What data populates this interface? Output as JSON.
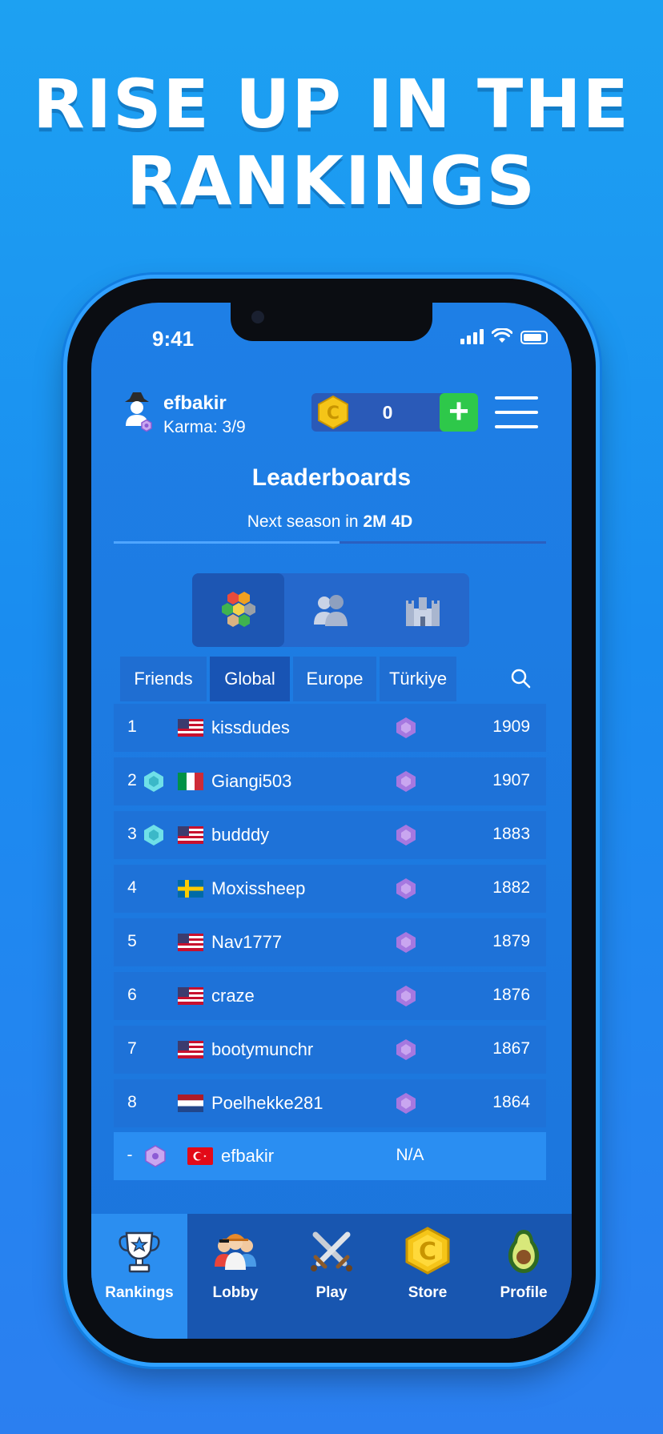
{
  "headline": {
    "line1": "RISE UP IN THE",
    "line2": "RANKINGS"
  },
  "status_bar": {
    "time": "9:41"
  },
  "user": {
    "name": "efbakir",
    "karma": "Karma: 3/9"
  },
  "currency": {
    "count": "0",
    "add_label": "+"
  },
  "page": {
    "title": "Leaderboards",
    "season_prefix": "Next season in ",
    "season_value": "2M 4D"
  },
  "mode_tabs": [
    {
      "icon": "hex-board-icon",
      "active": true
    },
    {
      "icon": "players-icon",
      "active": false
    },
    {
      "icon": "castle-icon",
      "active": false
    }
  ],
  "region_tabs": [
    {
      "label": "Friends",
      "active": false
    },
    {
      "label": "Global",
      "active": true
    },
    {
      "label": "Europe",
      "active": false
    },
    {
      "label": "Türkiye",
      "active": false
    }
  ],
  "leaderboard": [
    {
      "rank": "1",
      "badge": "",
      "flag": "us",
      "name": "kissdudes",
      "score": "1909"
    },
    {
      "rank": "2",
      "badge": "cyan-hex",
      "flag": "it",
      "name": "Giangi503",
      "score": "1907"
    },
    {
      "rank": "3",
      "badge": "cyan-hex",
      "flag": "us",
      "name": "budddy",
      "score": "1883"
    },
    {
      "rank": "4",
      "badge": "",
      "flag": "se",
      "name": "Moxissheep",
      "score": "1882"
    },
    {
      "rank": "5",
      "badge": "",
      "flag": "us",
      "name": "Nav1777",
      "score": "1879"
    },
    {
      "rank": "6",
      "badge": "",
      "flag": "us",
      "name": "craze",
      "score": "1876"
    },
    {
      "rank": "7",
      "badge": "",
      "flag": "us",
      "name": "bootymunchr",
      "score": "1867"
    },
    {
      "rank": "8",
      "badge": "",
      "flag": "nl",
      "name": "Poelhekke281",
      "score": "1864"
    }
  ],
  "my_row": {
    "rank": "-",
    "flag": "tr",
    "name": "efbakir",
    "score": "N/A"
  },
  "bottom_nav": [
    {
      "label": "Rankings",
      "icon": "trophy-icon",
      "active": true
    },
    {
      "label": "Lobby",
      "icon": "lobby-icon",
      "active": false
    },
    {
      "label": "Play",
      "icon": "crossed-swords-icon",
      "active": false
    },
    {
      "label": "Store",
      "icon": "coin-icon",
      "active": false
    },
    {
      "label": "Profile",
      "icon": "avocado-icon",
      "active": false
    }
  ],
  "colors": {
    "accent_green": "#2ec84a",
    "coin_gold": "#f5c518",
    "league_purple": "#a678e0"
  }
}
